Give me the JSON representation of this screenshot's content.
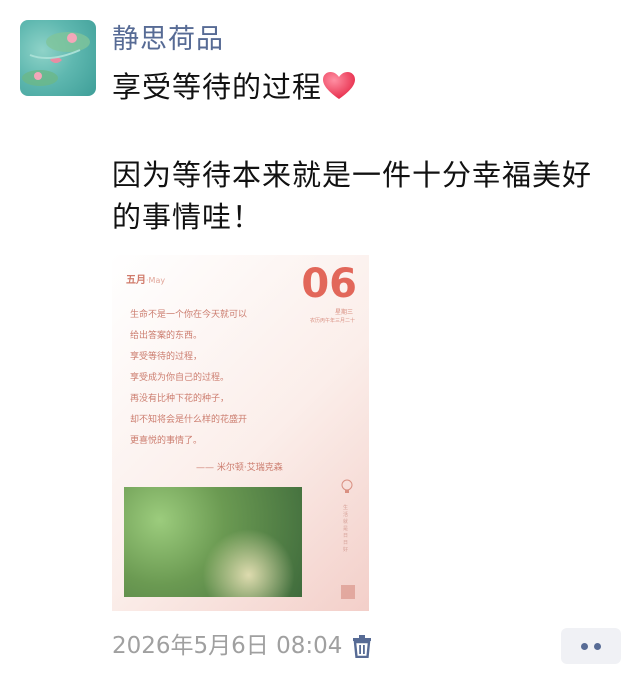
{
  "post": {
    "author": "静思荷品",
    "lines": [
      "享受等待的过程",
      "因为等待本来就是一件十分幸福美好",
      "的事情哇！"
    ],
    "timestamp": "2026年5月6日 08:04"
  },
  "card": {
    "month": "五月",
    "month_en": "·May",
    "day": "06",
    "weekday": "星期三",
    "lunar": "农历丙午年三月二十",
    "poem": [
      "生命不是一个你在今天就可以",
      "给出答案的东西。",
      "享受等待的过程，",
      "享受成为你自己的过程。",
      "再没有比种下花的种子，",
      "却不知将会是什么样的花盛开",
      "更喜悦的事情了。"
    ],
    "attribution": "—— 米尔顿·艾瑞克森",
    "vertical_text": "生活就是日日好"
  },
  "icons": {
    "avatar": "lotus-pond-avatar",
    "heart": "red-heart-emoji",
    "trash": "trash-icon",
    "more": "more-dots-icon"
  },
  "colors": {
    "author": "#576b95",
    "text": "#111111",
    "timestamp": "#a0a0a0"
  }
}
